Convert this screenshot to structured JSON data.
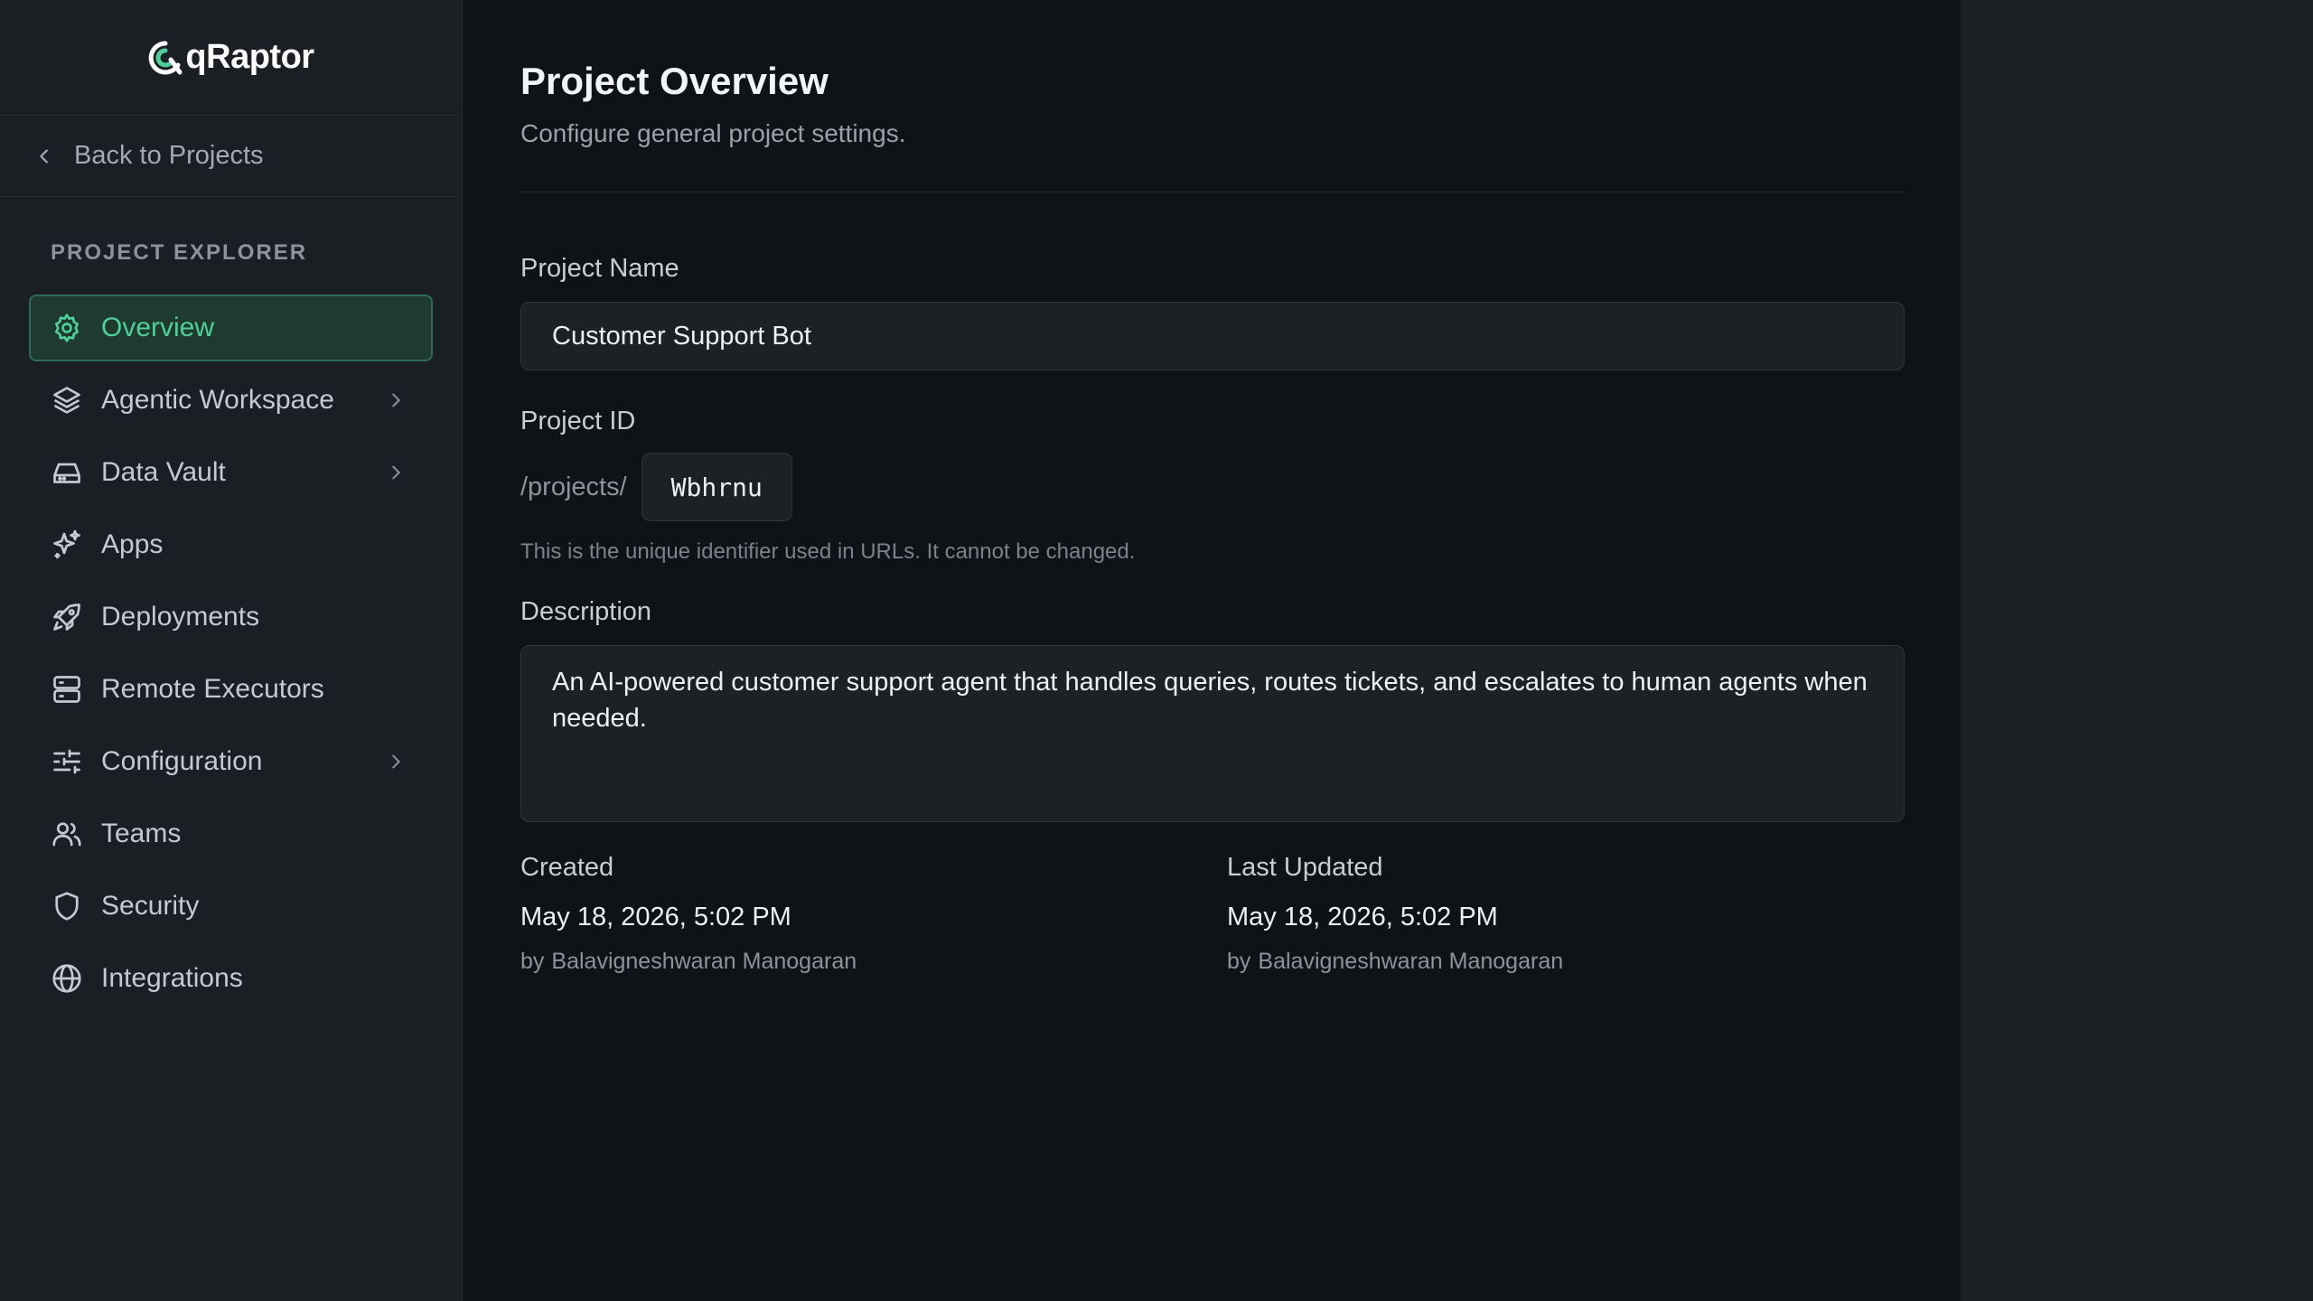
{
  "brand": {
    "name": "qRaptor"
  },
  "sidebar": {
    "back_label": "Back to Projects",
    "section_title": "PROJECT EXPLORER",
    "items": [
      {
        "label": "Overview",
        "icon": "gear-icon",
        "active": true,
        "has_children": false
      },
      {
        "label": "Agentic Workspace",
        "icon": "layers-icon",
        "active": false,
        "has_children": true
      },
      {
        "label": "Data Vault",
        "icon": "hard-drive-icon",
        "active": false,
        "has_children": true
      },
      {
        "label": "Apps",
        "icon": "sparkles-icon",
        "active": false,
        "has_children": false
      },
      {
        "label": "Deployments",
        "icon": "rocket-icon",
        "active": false,
        "has_children": false
      },
      {
        "label": "Remote Executors",
        "icon": "server-icon",
        "active": false,
        "has_children": false
      },
      {
        "label": "Configuration",
        "icon": "sliders-icon",
        "active": false,
        "has_children": true
      },
      {
        "label": "Teams",
        "icon": "users-icon",
        "active": false,
        "has_children": false
      },
      {
        "label": "Security",
        "icon": "shield-icon",
        "active": false,
        "has_children": false
      },
      {
        "label": "Integrations",
        "icon": "globe-icon",
        "active": false,
        "has_children": false
      }
    ]
  },
  "main": {
    "title": "Project Overview",
    "subtitle": "Configure general project settings.",
    "project_name": {
      "label": "Project Name",
      "value": "Customer Support Bot"
    },
    "project_id": {
      "label": "Project ID",
      "prefix": "/projects/",
      "value": "Wbhrnu",
      "hint": "This is the unique identifier used in URLs. It cannot be changed."
    },
    "description": {
      "label": "Description",
      "value": "An AI-powered customer support agent that handles queries, routes tickets, and escalates to human agents when needed."
    },
    "created": {
      "label": "Created",
      "date": "May 18, 2026, 5:02 PM",
      "by_prefix": "by",
      "by": "Balavigneshwaran Manogaran"
    },
    "updated": {
      "label": "Last Updated",
      "date": "May 18, 2026, 5:02 PM",
      "by_prefix": "by",
      "by": "Balavigneshwaran Manogaran"
    }
  },
  "colors": {
    "accent": "#4fcf9a",
    "active_bg": "#1f3a30",
    "sidebar_bg": "#1b1f23",
    "main_bg": "#0f1316"
  }
}
